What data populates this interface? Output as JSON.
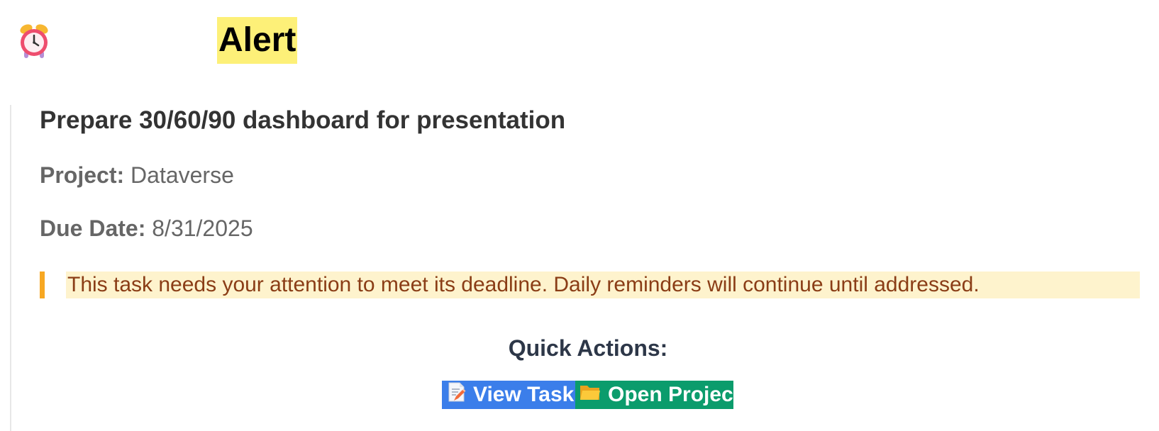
{
  "header": {
    "icon": "alarm-clock-icon",
    "title": "Alert"
  },
  "task": {
    "title": "Prepare 30/60/90 dashboard for presentation",
    "project_label": "Project:",
    "project_value": "Dataverse",
    "due_label": "Due Date:",
    "due_value": "8/31/2025"
  },
  "notice": {
    "text": "This task needs your attention to meet its deadline. Daily reminders will continue until addressed.",
    "accent_color": "#f7a823",
    "background_color": "#fef3cd"
  },
  "quick_actions": {
    "heading": "Quick Actions:",
    "view_task": {
      "icon": "memo-icon",
      "label": "View Task",
      "color": "#3b7eea"
    },
    "open_project": {
      "icon": "folder-icon",
      "label": "Open Project",
      "color": "#0b9c6c"
    }
  }
}
